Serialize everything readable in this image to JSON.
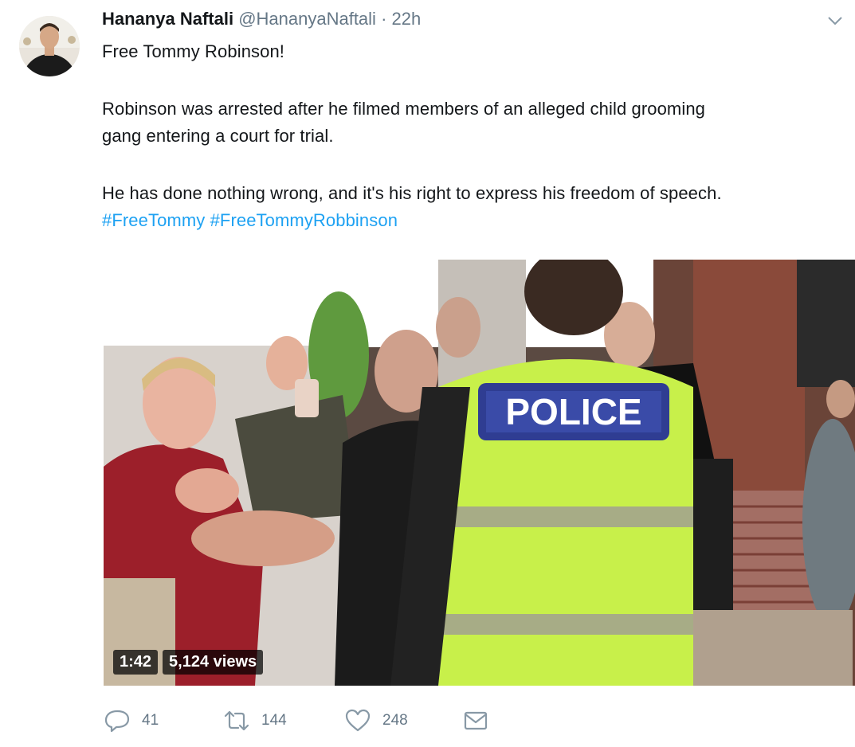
{
  "tweet": {
    "author_name": "Hananya Naftali",
    "handle": "@HananyaNaftali",
    "separator": "·",
    "time": "22h",
    "line1": "Free Tommy Robinson!",
    "line2": "Robinson was arrested after he filmed members of an alleged child grooming",
    "line3": "gang entering a court for trial.",
    "line4": "He has done nothing wrong, and it's his right to express his freedom of speech.",
    "hashtag1": "#FreeTommy",
    "hashtag2": "#FreeTommyRobbinson"
  },
  "video": {
    "duration": "1:42",
    "views": "5,124 views",
    "vest_text": "POLICE"
  },
  "actions": {
    "replies": "41",
    "retweets": "144",
    "likes": "248"
  },
  "icons": {
    "reply": "reply-icon",
    "retweet": "retweet-icon",
    "like": "heart-icon",
    "message": "envelope-icon",
    "menu": "chevron-down-icon"
  },
  "colors": {
    "hashtag": "#1da1f2",
    "meta": "#657786",
    "text": "#14171a"
  }
}
